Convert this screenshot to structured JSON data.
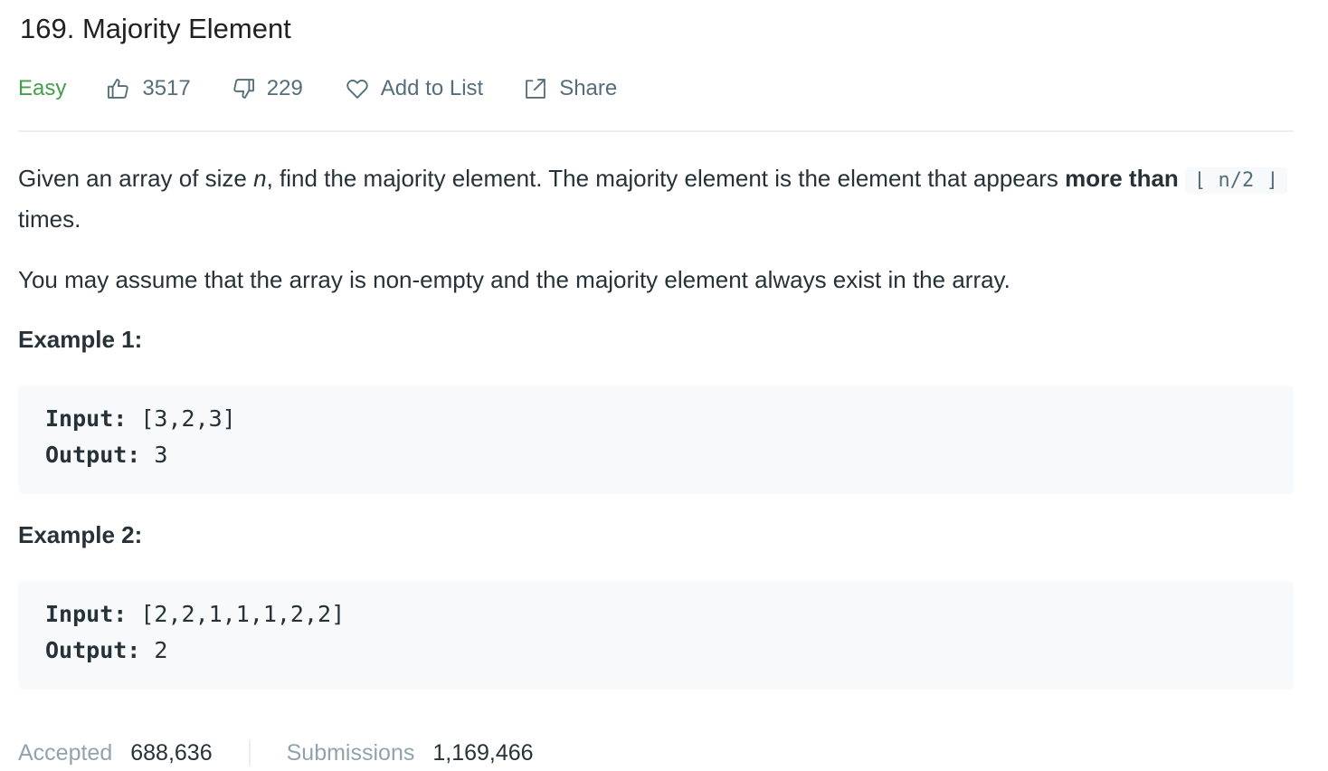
{
  "problem": {
    "title": "169. Majority Element",
    "difficulty": "Easy",
    "likes": "3517",
    "dislikes": "229",
    "add_to_list_label": "Add to List",
    "share_label": "Share"
  },
  "description": {
    "p1_part1": "Given an array of size ",
    "p1_var": "n",
    "p1_part2": ", find the majority element. The majority element is the element that appears ",
    "p1_bold": "more than",
    "p1_code": "⌊ n/2 ⌋",
    "p1_part3": " times.",
    "p2": "You may assume that the array is non-empty and the majority element always exist in the array."
  },
  "examples": [
    {
      "title": "Example 1:",
      "input_label": "Input:",
      "input_value": " [3,2,3]",
      "output_label": "Output:",
      "output_value": " 3"
    },
    {
      "title": "Example 2:",
      "input_label": "Input:",
      "input_value": " [2,2,1,1,1,2,2]",
      "output_label": "Output:",
      "output_value": " 2"
    }
  ],
  "stats": {
    "accepted_label": "Accepted",
    "accepted_value": "688,636",
    "submissions_label": "Submissions",
    "submissions_value": "1,169,466"
  },
  "colors": {
    "easy": "#43a047",
    "meta_text": "#546e7a",
    "code_bg": "#f7f9fa"
  },
  "icons": {
    "like": "thumbs-up-icon",
    "dislike": "thumbs-down-icon",
    "add_to_list": "heart-icon",
    "share": "share-icon"
  }
}
